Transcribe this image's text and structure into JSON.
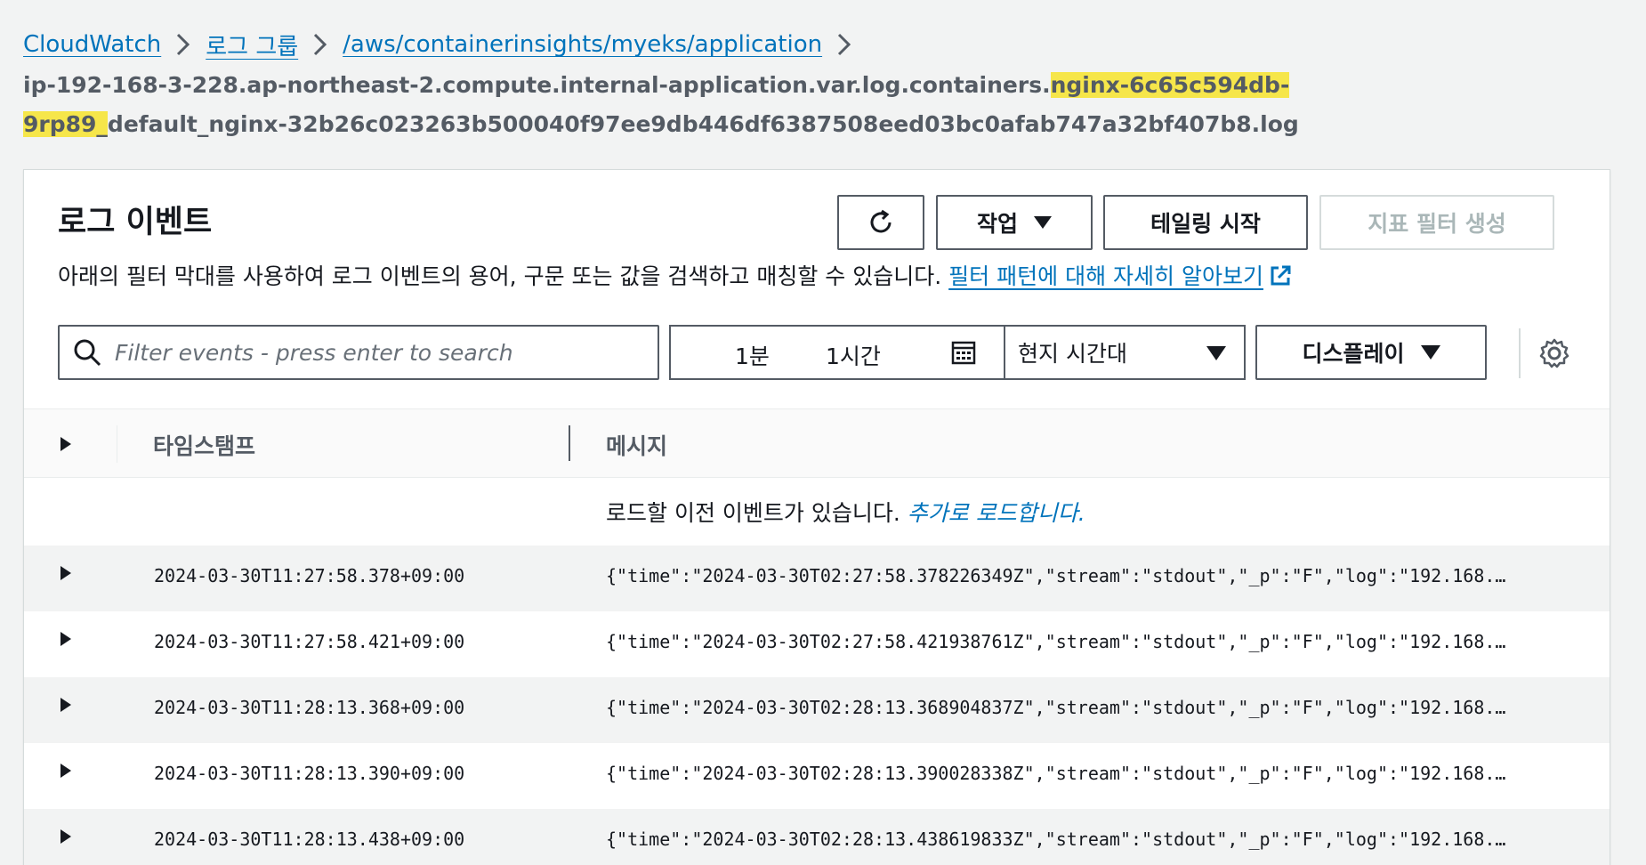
{
  "breadcrumb": {
    "items": [
      "CloudWatch",
      "로그 그룹",
      "/aws/containerinsights/myeks/application"
    ]
  },
  "stream": {
    "prefix": "ip-192-168-3-228.ap-northeast-2.compute.internal-application.var.log.containers.",
    "highlight": "nginx-6c65c594db-9rp89_",
    "suffix": "default_nginx-32b26c023263b500040f97ee9db446df6387508eed03bc0afab747a32bf407b8.log"
  },
  "panel": {
    "title": "로그 이벤트",
    "description": "아래의 필터 막대를 사용하여 로그 이벤트의 용어, 구문 또는 값을 검색하고 매칭할 수 있습니다.",
    "learn_more": "필터 패턴에 대해 자세히 알아보기"
  },
  "toolbar": {
    "actions_label": "작업",
    "tailing_label": "테일링 시작",
    "metric_filter_label": "지표 필터 생성"
  },
  "filter": {
    "placeholder": "Filter events - press enter to search",
    "range_1": "1분",
    "range_2": "1시간",
    "timezone": "현지 시간대",
    "display_label": "디스플레이"
  },
  "table": {
    "col_timestamp": "타임스탬프",
    "col_message": "메시지",
    "load_text": "로드할 이전 이벤트가 있습니다.",
    "load_more": "추가로 로드합니다.",
    "rows": [
      {
        "ts": "2024-03-30T11:27:58.378+09:00",
        "msg": "{\"time\":\"2024-03-30T02:27:58.378226349Z\",\"stream\":\"stdout\",\"_p\":\"F\",\"log\":\"192.168.…"
      },
      {
        "ts": "2024-03-30T11:27:58.421+09:00",
        "msg": "{\"time\":\"2024-03-30T02:27:58.421938761Z\",\"stream\":\"stdout\",\"_p\":\"F\",\"log\":\"192.168.…"
      },
      {
        "ts": "2024-03-30T11:28:13.368+09:00",
        "msg": "{\"time\":\"2024-03-30T02:28:13.368904837Z\",\"stream\":\"stdout\",\"_p\":\"F\",\"log\":\"192.168.…"
      },
      {
        "ts": "2024-03-30T11:28:13.390+09:00",
        "msg": "{\"time\":\"2024-03-30T02:28:13.390028338Z\",\"stream\":\"stdout\",\"_p\":\"F\",\"log\":\"192.168.…"
      },
      {
        "ts": "2024-03-30T11:28:13.438+09:00",
        "msg": "{\"time\":\"2024-03-30T02:28:13.438619833Z\",\"stream\":\"stdout\",\"_p\":\"F\",\"log\":\"192.168.…"
      }
    ]
  },
  "colors": {
    "link": "#0073bb",
    "highlight": "#f6e64a",
    "border": "#545b64"
  }
}
